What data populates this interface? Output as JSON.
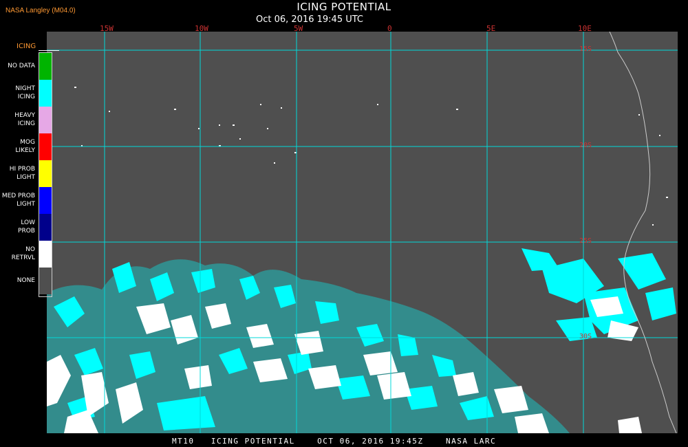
{
  "header": {
    "org": "NASA Langley (M04.0)",
    "title": "ICING POTENTIAL",
    "subtitle": "Oct 06, 2016 19:45 UTC"
  },
  "grid": {
    "longitude_labels": [
      "15W",
      "10W",
      "5W",
      "0",
      "5E",
      "10E"
    ],
    "latitude_labels": [
      "15S",
      "20S",
      "25S",
      "30S"
    ]
  },
  "legend": {
    "title": "ICING",
    "items": [
      {
        "label": "NO DATA",
        "color": "#00b400"
      },
      {
        "label": "NIGHT\nICING",
        "color": "#00ffff"
      },
      {
        "label": "HEAVY\nICING",
        "color": "#e6a8e6"
      },
      {
        "label": "MOG\nLIKELY",
        "color": "#ff0000"
      },
      {
        "label": "HI PROB\nLIGHT",
        "color": "#ffff00"
      },
      {
        "label": "MED PROB\nLIGHT",
        "color": "#0000ff"
      },
      {
        "label": "LOW\nPROB",
        "color": "#00008b"
      },
      {
        "label": "NO\nRETRVL",
        "color": "#ffffff"
      },
      {
        "label": "NONE",
        "color": "#4f4f4f"
      }
    ]
  },
  "footer": {
    "text": "MT10   ICING POTENTIAL    OCT 06, 2016 19:45Z    NASA LARC"
  },
  "colors": {
    "background": "#000000",
    "map_fill": "#4f4f4f",
    "gridline": "#00d8d8",
    "grid_label": "#cc3333",
    "icing_cloud": "#00ffff",
    "no_retrieval": "#ffffff",
    "coastline": "#cccccc"
  }
}
